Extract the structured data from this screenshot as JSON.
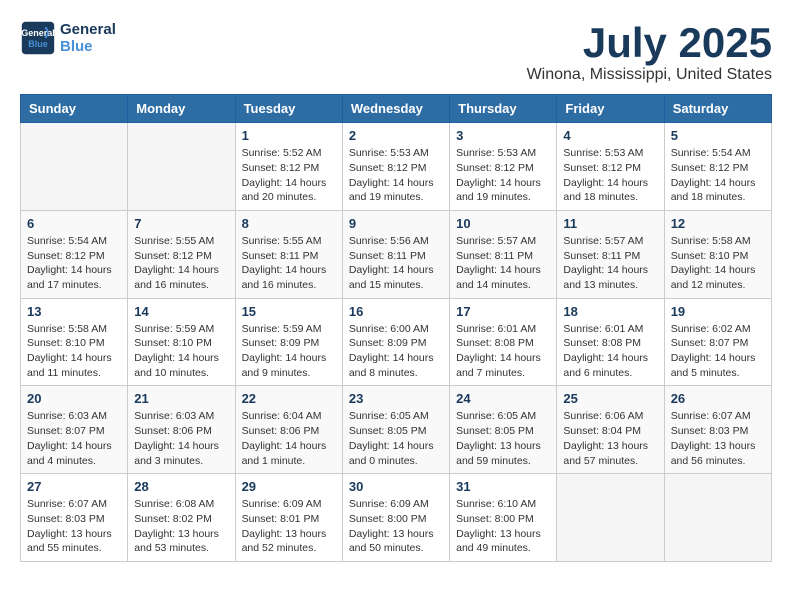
{
  "header": {
    "logo_line1": "General",
    "logo_line2": "Blue",
    "month_title": "July 2025",
    "location": "Winona, Mississippi, United States"
  },
  "weekdays": [
    "Sunday",
    "Monday",
    "Tuesday",
    "Wednesday",
    "Thursday",
    "Friday",
    "Saturday"
  ],
  "weeks": [
    [
      {
        "day": "",
        "info": ""
      },
      {
        "day": "",
        "info": ""
      },
      {
        "day": "1",
        "info": "Sunrise: 5:52 AM\nSunset: 8:12 PM\nDaylight: 14 hours and 20 minutes."
      },
      {
        "day": "2",
        "info": "Sunrise: 5:53 AM\nSunset: 8:12 PM\nDaylight: 14 hours and 19 minutes."
      },
      {
        "day": "3",
        "info": "Sunrise: 5:53 AM\nSunset: 8:12 PM\nDaylight: 14 hours and 19 minutes."
      },
      {
        "day": "4",
        "info": "Sunrise: 5:53 AM\nSunset: 8:12 PM\nDaylight: 14 hours and 18 minutes."
      },
      {
        "day": "5",
        "info": "Sunrise: 5:54 AM\nSunset: 8:12 PM\nDaylight: 14 hours and 18 minutes."
      }
    ],
    [
      {
        "day": "6",
        "info": "Sunrise: 5:54 AM\nSunset: 8:12 PM\nDaylight: 14 hours and 17 minutes."
      },
      {
        "day": "7",
        "info": "Sunrise: 5:55 AM\nSunset: 8:12 PM\nDaylight: 14 hours and 16 minutes."
      },
      {
        "day": "8",
        "info": "Sunrise: 5:55 AM\nSunset: 8:11 PM\nDaylight: 14 hours and 16 minutes."
      },
      {
        "day": "9",
        "info": "Sunrise: 5:56 AM\nSunset: 8:11 PM\nDaylight: 14 hours and 15 minutes."
      },
      {
        "day": "10",
        "info": "Sunrise: 5:57 AM\nSunset: 8:11 PM\nDaylight: 14 hours and 14 minutes."
      },
      {
        "day": "11",
        "info": "Sunrise: 5:57 AM\nSunset: 8:11 PM\nDaylight: 14 hours and 13 minutes."
      },
      {
        "day": "12",
        "info": "Sunrise: 5:58 AM\nSunset: 8:10 PM\nDaylight: 14 hours and 12 minutes."
      }
    ],
    [
      {
        "day": "13",
        "info": "Sunrise: 5:58 AM\nSunset: 8:10 PM\nDaylight: 14 hours and 11 minutes."
      },
      {
        "day": "14",
        "info": "Sunrise: 5:59 AM\nSunset: 8:10 PM\nDaylight: 14 hours and 10 minutes."
      },
      {
        "day": "15",
        "info": "Sunrise: 5:59 AM\nSunset: 8:09 PM\nDaylight: 14 hours and 9 minutes."
      },
      {
        "day": "16",
        "info": "Sunrise: 6:00 AM\nSunset: 8:09 PM\nDaylight: 14 hours and 8 minutes."
      },
      {
        "day": "17",
        "info": "Sunrise: 6:01 AM\nSunset: 8:08 PM\nDaylight: 14 hours and 7 minutes."
      },
      {
        "day": "18",
        "info": "Sunrise: 6:01 AM\nSunset: 8:08 PM\nDaylight: 14 hours and 6 minutes."
      },
      {
        "day": "19",
        "info": "Sunrise: 6:02 AM\nSunset: 8:07 PM\nDaylight: 14 hours and 5 minutes."
      }
    ],
    [
      {
        "day": "20",
        "info": "Sunrise: 6:03 AM\nSunset: 8:07 PM\nDaylight: 14 hours and 4 minutes."
      },
      {
        "day": "21",
        "info": "Sunrise: 6:03 AM\nSunset: 8:06 PM\nDaylight: 14 hours and 3 minutes."
      },
      {
        "day": "22",
        "info": "Sunrise: 6:04 AM\nSunset: 8:06 PM\nDaylight: 14 hours and 1 minute."
      },
      {
        "day": "23",
        "info": "Sunrise: 6:05 AM\nSunset: 8:05 PM\nDaylight: 14 hours and 0 minutes."
      },
      {
        "day": "24",
        "info": "Sunrise: 6:05 AM\nSunset: 8:05 PM\nDaylight: 13 hours and 59 minutes."
      },
      {
        "day": "25",
        "info": "Sunrise: 6:06 AM\nSunset: 8:04 PM\nDaylight: 13 hours and 57 minutes."
      },
      {
        "day": "26",
        "info": "Sunrise: 6:07 AM\nSunset: 8:03 PM\nDaylight: 13 hours and 56 minutes."
      }
    ],
    [
      {
        "day": "27",
        "info": "Sunrise: 6:07 AM\nSunset: 8:03 PM\nDaylight: 13 hours and 55 minutes."
      },
      {
        "day": "28",
        "info": "Sunrise: 6:08 AM\nSunset: 8:02 PM\nDaylight: 13 hours and 53 minutes."
      },
      {
        "day": "29",
        "info": "Sunrise: 6:09 AM\nSunset: 8:01 PM\nDaylight: 13 hours and 52 minutes."
      },
      {
        "day": "30",
        "info": "Sunrise: 6:09 AM\nSunset: 8:00 PM\nDaylight: 13 hours and 50 minutes."
      },
      {
        "day": "31",
        "info": "Sunrise: 6:10 AM\nSunset: 8:00 PM\nDaylight: 13 hours and 49 minutes."
      },
      {
        "day": "",
        "info": ""
      },
      {
        "day": "",
        "info": ""
      }
    ]
  ]
}
